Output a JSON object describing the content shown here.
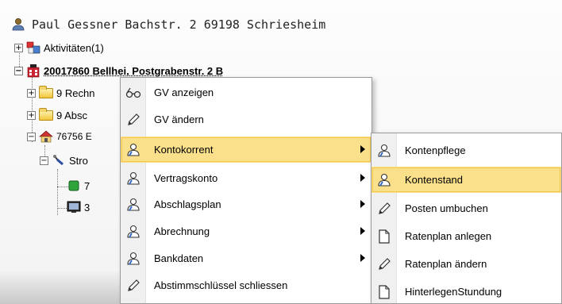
{
  "header": {
    "title": "Paul Gessner Bachstr. 2 69198 Schriesheim",
    "icon": "person-icon"
  },
  "tree": {
    "activities": "Aktivitäten(1)",
    "contract_node": "20017860 Bellhei, Postgrabenstr. 2 B",
    "folder1": "9 Rechn",
    "folder2": "9 Absc",
    "account_node": "76756 E",
    "strom_node": "Stro",
    "leaf1": "7",
    "leaf2": "3"
  },
  "menu": {
    "items": [
      {
        "label": "GV anzeigen",
        "icon": "glasses-icon",
        "submenu": false
      },
      {
        "label": "GV ändern",
        "icon": "pencil-icon",
        "submenu": false
      },
      {
        "label": "Kontokorrent",
        "icon": "user-icon",
        "submenu": true,
        "highlighted": true
      },
      {
        "label": "Vertragskonto",
        "icon": "user-icon",
        "submenu": true
      },
      {
        "label": "Abschlagsplan",
        "icon": "user-icon",
        "submenu": true
      },
      {
        "label": "Abrechnung",
        "icon": "user-icon",
        "submenu": true
      },
      {
        "label": "Bankdaten",
        "icon": "user-icon",
        "submenu": true
      },
      {
        "label": "Abstimmschlüssel schliessen",
        "icon": "pencil-icon",
        "submenu": false
      }
    ]
  },
  "submenu": {
    "items": [
      {
        "label": "Kontenpflege",
        "icon": "user-icon"
      },
      {
        "label": "Kontenstand",
        "icon": "user-icon",
        "highlighted": true
      },
      {
        "label": "Posten umbuchen",
        "icon": "pencil-icon"
      },
      {
        "label": "Ratenplan anlegen",
        "icon": "document-icon"
      },
      {
        "label": "Ratenplan ändern",
        "icon": "pencil-icon"
      },
      {
        "label": "HinterlegenStundung",
        "icon": "document-icon"
      }
    ]
  },
  "colors": {
    "highlight": "#fbe08c",
    "highlight_border": "#f5c64a",
    "menu_strip": "#f0f0f0"
  }
}
